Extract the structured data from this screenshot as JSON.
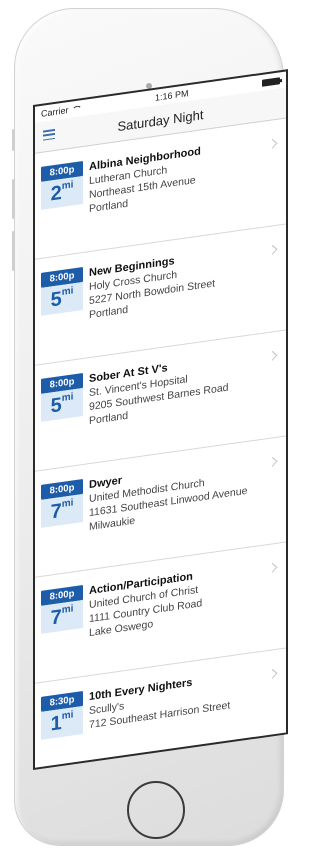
{
  "status": {
    "carrier": "Carrier",
    "time": "1:16 PM"
  },
  "nav": {
    "title": "Saturday Night"
  },
  "meetings": [
    {
      "time": "8:00p",
      "distance": "2",
      "unit": "mi",
      "name": "Albina Neighborhood",
      "place": "Lutheran Church",
      "street": "Northeast 15th Avenue",
      "city": "Portland"
    },
    {
      "time": "8:00p",
      "distance": "5",
      "unit": "mi",
      "name": "New Beginnings",
      "place": "Holy Cross Church",
      "street": "5227 North Bowdoin Street",
      "city": "Portland"
    },
    {
      "time": "8:00p",
      "distance": "5",
      "unit": "mi",
      "name": "Sober At St V's",
      "place": "St. Vincent's Hopsital",
      "street": "9205 Southwest Barnes Road",
      "city": "Portland"
    },
    {
      "time": "8:00p",
      "distance": "7",
      "unit": "mi",
      "name": "Dwyer",
      "place": "United Methodist Church",
      "street": "11631 Southeast Linwood Avenue",
      "city": "Milwaukie"
    },
    {
      "time": "8:00p",
      "distance": "7",
      "unit": "mi",
      "name": "Action/Participation",
      "place": "United Church of Christ",
      "street": "1111 Country Club Road",
      "city": "Lake Oswego"
    },
    {
      "time": "8:30p",
      "distance": "1",
      "unit": "mi",
      "name": "10th Every Nighters",
      "place": "Scully's",
      "street": "712 Southeast Harrison Street",
      "city": ""
    }
  ]
}
